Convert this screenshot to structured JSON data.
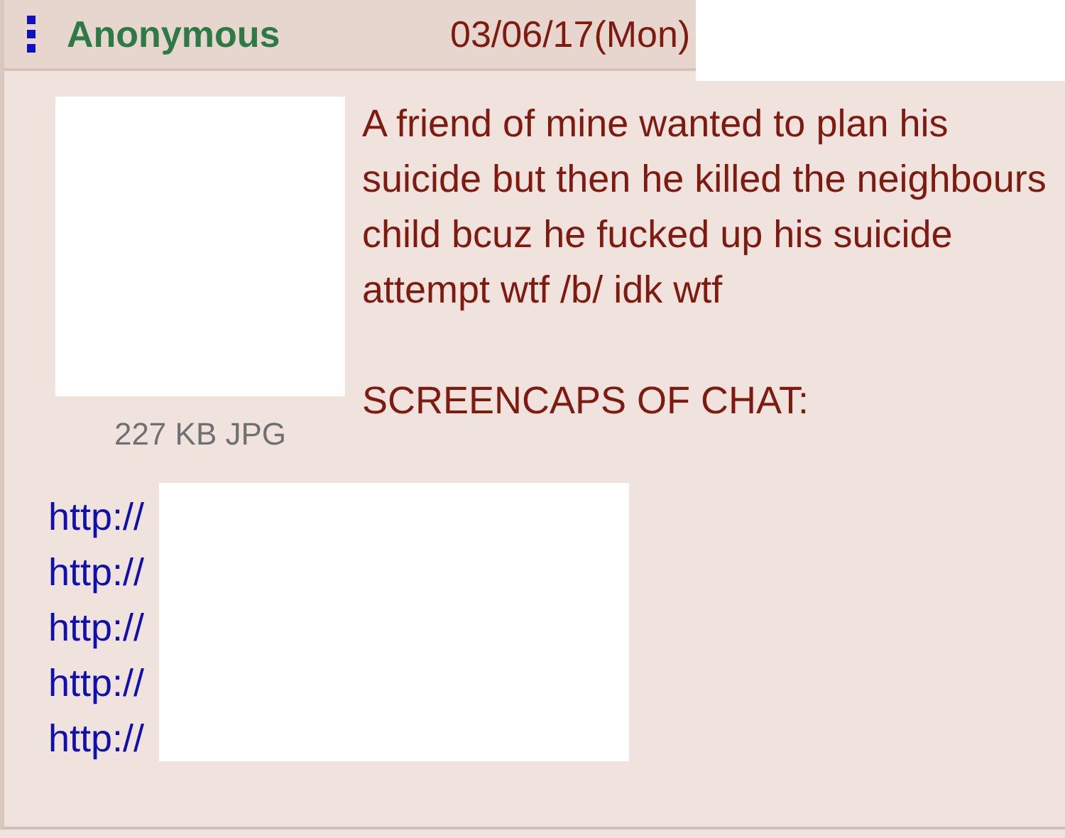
{
  "post": {
    "name": "Anonymous",
    "date": "03/06/17(Mon)",
    "file_info": "227 KB JPG",
    "message": [
      "A friend of mine wanted to plan his suicide but then he killed the neighbours child bcuz he fucked up his suicide attempt wtf /b/ idk wtf",
      "SCREENCAPS OF CHAT:"
    ],
    "links": [
      "http://",
      "http://",
      "http://",
      "http://",
      "http://"
    ]
  }
}
